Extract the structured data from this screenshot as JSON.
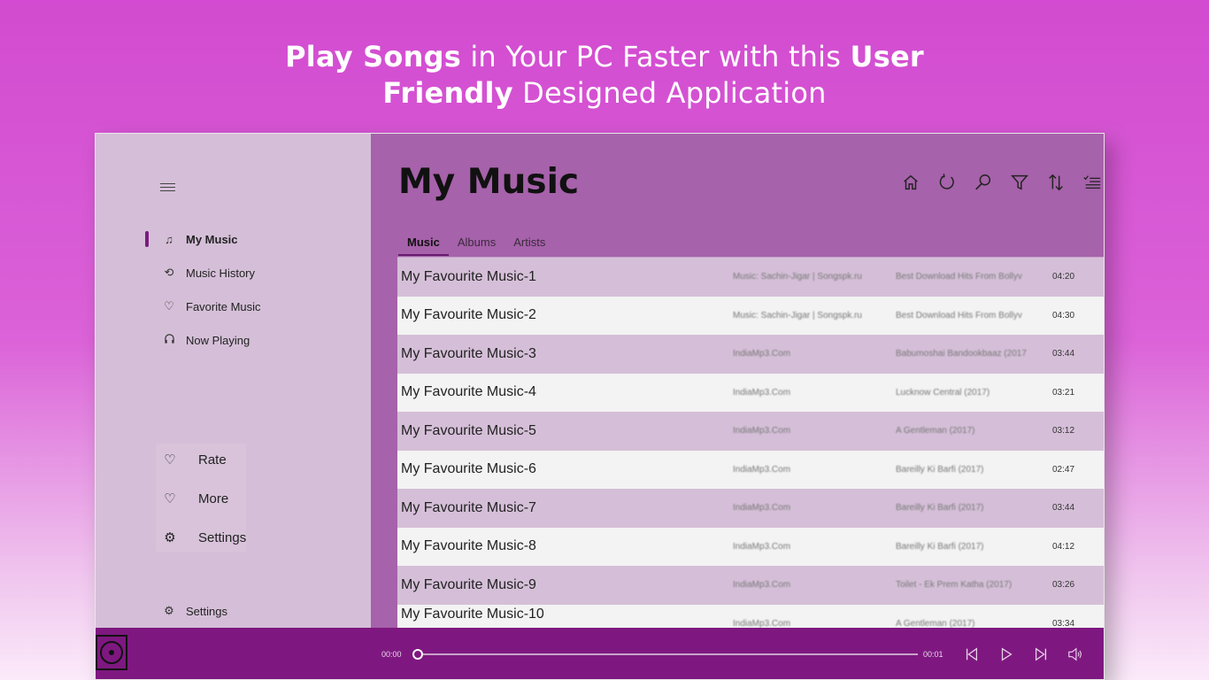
{
  "headline": {
    "p1": "Play Songs",
    "p2": " in Your PC Faster with this ",
    "p3": "User",
    "p4": "Friendly",
    "p5": " Designed Application"
  },
  "sidebar": {
    "items": [
      {
        "label": "My Music",
        "icon": "music-note-icon"
      },
      {
        "label": "Music History",
        "icon": "history-icon"
      },
      {
        "label": "Favorite Music",
        "icon": "heart-icon"
      },
      {
        "label": "Now Playing",
        "icon": "headphones-icon"
      }
    ],
    "actions": [
      {
        "label": "Rate",
        "icon": "heart-icon"
      },
      {
        "label": "More",
        "icon": "heart-icon"
      },
      {
        "label": "Settings",
        "icon": "gear-icon"
      }
    ],
    "footer_settings": "Settings"
  },
  "main": {
    "title": "My Music",
    "tabs": [
      "Music",
      "Albums",
      "Artists"
    ],
    "toolbar_icons": [
      "home-icon",
      "refresh-icon",
      "search-icon",
      "filter-icon",
      "sort-icon",
      "select-list-icon"
    ]
  },
  "songs": [
    {
      "title": "My Favourite Music-1",
      "artist": "Music: Sachin-Jigar | Songspk.ru",
      "album": "Best Download Hits From Bollyv",
      "duration": "04:20"
    },
    {
      "title": "My Favourite Music-2",
      "artist": "Music: Sachin-Jigar | Songspk.ru",
      "album": "Best Download Hits From Bollyv",
      "duration": "04:30"
    },
    {
      "title": "My Favourite Music-3",
      "artist": "IndiaMp3.Com",
      "album": "Babumoshai Bandookbaaz (2017",
      "duration": "03:44"
    },
    {
      "title": "My Favourite Music-4",
      "artist": "IndiaMp3.Com",
      "album": "Lucknow Central (2017)",
      "duration": "03:21"
    },
    {
      "title": "My Favourite Music-5",
      "artist": "IndiaMp3.Com",
      "album": "A Gentleman (2017)",
      "duration": "03:12"
    },
    {
      "title": "My Favourite Music-6",
      "artist": "IndiaMp3.Com",
      "album": "Bareilly Ki Barfi (2017)",
      "duration": "02:47"
    },
    {
      "title": "My Favourite Music-7",
      "artist": "IndiaMp3.Com",
      "album": "Bareilly Ki Barfi (2017)",
      "duration": "03:44"
    },
    {
      "title": "My Favourite Music-8",
      "artist": "IndiaMp3.Com",
      "album": "Bareilly Ki Barfi (2017)",
      "duration": "04:12"
    },
    {
      "title": "My Favourite Music-9",
      "artist": "IndiaMp3.Com",
      "album": "Toilet - Ek Prem Katha (2017)",
      "duration": "03:26"
    },
    {
      "title": "My Favourite Music-10",
      "artist": "IndiaMp3.Com",
      "album": "A Gentleman (2017)",
      "duration": "03:34"
    }
  ],
  "player": {
    "current_time": "00:00",
    "total_time": "00:01",
    "progress": 0,
    "icons": [
      "previous-icon",
      "play-icon",
      "next-icon",
      "volume-icon"
    ]
  },
  "colors": {
    "accent": "#7e1880",
    "sidebar_bg": "#d5bfd8",
    "main_bg": "#a662aa"
  }
}
